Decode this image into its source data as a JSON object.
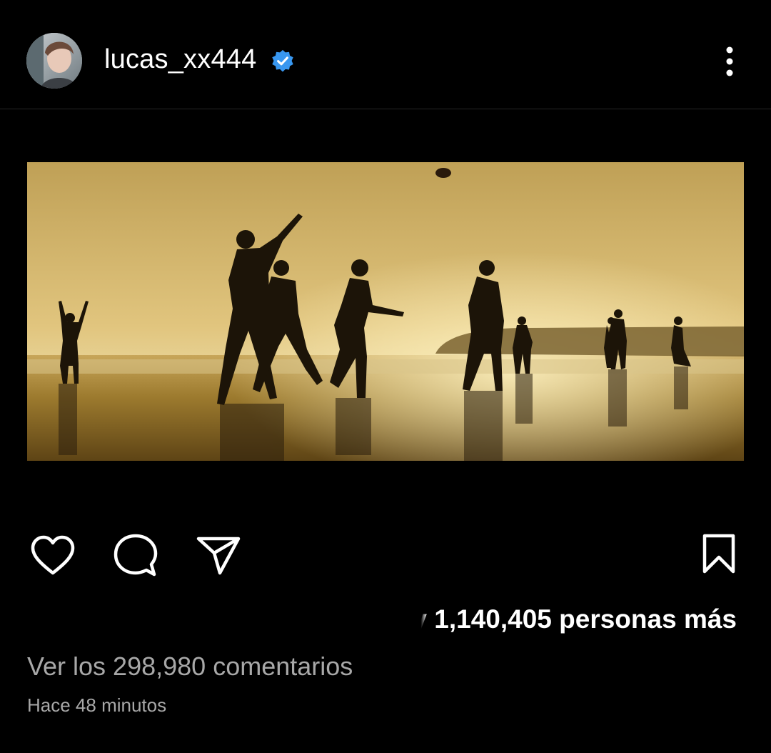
{
  "header": {
    "username": "lucas_xx444",
    "verified": true,
    "avatar_icon": "user-avatar",
    "menu_icon": "more-vertical-icon"
  },
  "post": {
    "image_description_icon": "beach-photo"
  },
  "actions": {
    "like_icon": "heart-icon",
    "comment_icon": "comment-icon",
    "share_icon": "send-icon",
    "save_icon": "bookmark-icon"
  },
  "likes": {
    "prefix_faded": "y",
    "text": "1,140,405 personas más"
  },
  "comments": {
    "label": "Ver los 298,980 comentarios"
  },
  "time": {
    "label": "Hace 48 minutos"
  },
  "colors": {
    "background": "#000000",
    "verified_blue": "#3897f0",
    "muted_text": "#a8a8a8"
  }
}
